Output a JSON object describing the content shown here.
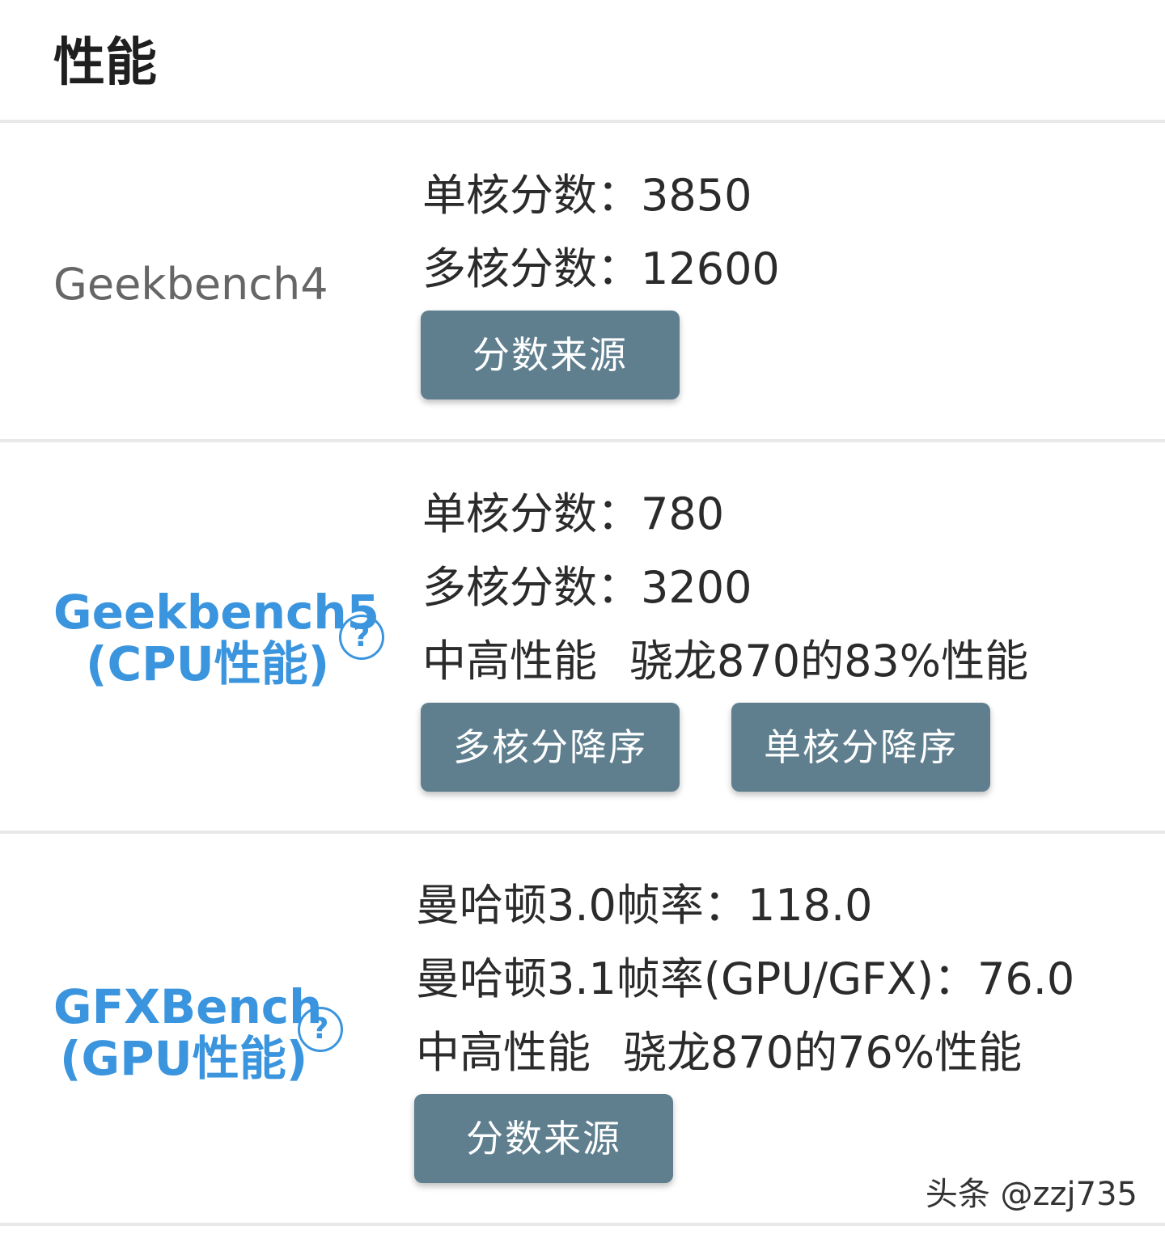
{
  "header": {
    "title": "性能"
  },
  "geekbench4": {
    "name": "Geekbench4",
    "single_label": "单核分数：",
    "single_value": "3850",
    "multi_label": "多核分数：",
    "multi_value": "12600",
    "source_button": "分数来源"
  },
  "geekbench5": {
    "name_line1": "Geekbench5",
    "name_line2": "(CPU性能)",
    "help": "?",
    "single_label": "单核分数：",
    "single_value": "780",
    "multi_label": "多核分数：",
    "multi_value": "3200",
    "level": "中高性能",
    "comparison": "骁龙870的83%性能",
    "multi_sort_button": "多核分降序",
    "single_sort_button": "单核分降序"
  },
  "gfxbench": {
    "name_line1": "GFXBench",
    "name_line2": "(GPU性能)",
    "help": "?",
    "manhattan30_label": "曼哈顿3.0帧率：",
    "manhattan30_value": "118.0",
    "manhattan31_label": "曼哈顿3.1帧率(GPU/GFX)：",
    "manhattan31_value": "76.0",
    "level": "中高性能",
    "comparison": "骁龙870的76%性能",
    "source_button": "分数来源"
  },
  "watermark": "头条 @zzj735",
  "colors": {
    "link": "#3a95de",
    "button": "#5f7f8f",
    "divider": "#e8e8e8"
  }
}
